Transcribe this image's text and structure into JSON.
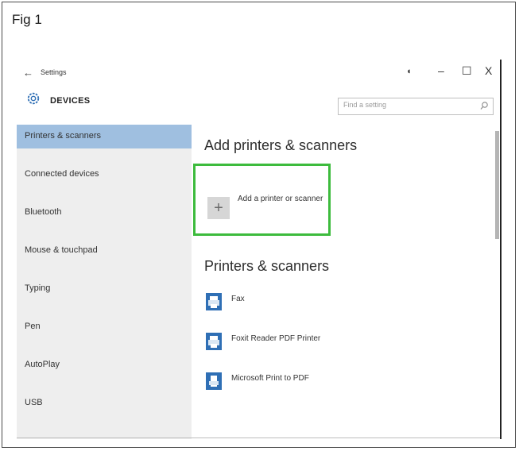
{
  "figure": {
    "label": "Fig 1"
  },
  "window": {
    "title": "Settings",
    "controls": {
      "minimize": "–",
      "maximize": "☐",
      "close": "X"
    }
  },
  "header": {
    "title": "DEVICES",
    "search_placeholder": "Find a setting"
  },
  "sidebar": {
    "items": [
      {
        "label": "Printers & scanners",
        "active": true
      },
      {
        "label": "Connected devices"
      },
      {
        "label": "Bluetooth"
      },
      {
        "label": "Mouse & touchpad"
      },
      {
        "label": "Typing"
      },
      {
        "label": "Pen"
      },
      {
        "label": "AutoPlay"
      },
      {
        "label": "USB"
      }
    ]
  },
  "main": {
    "add_heading": "Add printers & scanners",
    "add_button_label": "Add a printer or scanner",
    "add_highlight_color": "#3dbb3d",
    "list_heading": "Printers & scanners",
    "printers": [
      {
        "name": "Fax",
        "icon": "printer-icon"
      },
      {
        "name": "Foxit Reader PDF Printer",
        "icon": "printer-icon"
      },
      {
        "name": "Microsoft Print to PDF",
        "icon": "document-printer-icon"
      }
    ]
  },
  "colors": {
    "accent": "#2f6fb5",
    "active_nav": "#9fbfe0"
  }
}
